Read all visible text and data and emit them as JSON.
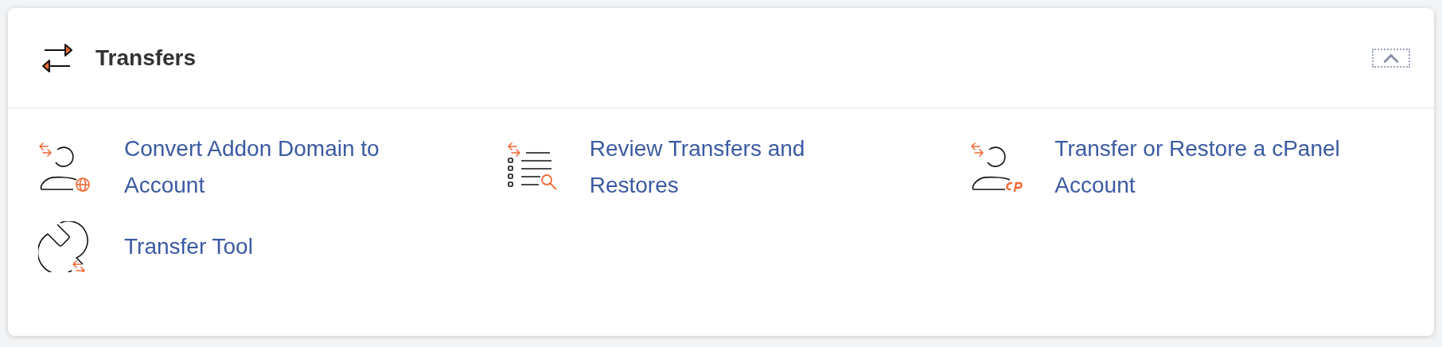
{
  "panel": {
    "title": "Transfers",
    "expanded": true
  },
  "items": [
    {
      "kind": "account-globe",
      "label": "Convert Addon Domain to Account"
    },
    {
      "kind": "list-search",
      "label": "Review Transfers and Restores"
    },
    {
      "kind": "account-cp",
      "label": "Transfer or Restore a cPanel Account"
    },
    {
      "kind": "wrench",
      "label": "Transfer Tool"
    }
  ]
}
